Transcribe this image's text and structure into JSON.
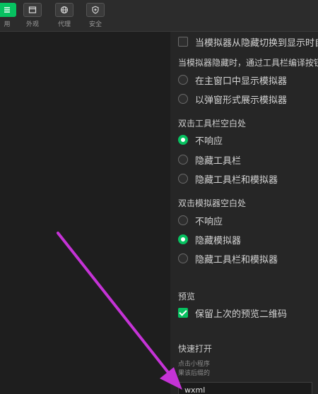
{
  "toolbar": {
    "buttons": [
      {
        "label": "用",
        "icon": "list-icon",
        "active": true
      },
      {
        "label": "外观",
        "icon": "window-icon",
        "active": false
      },
      {
        "label": "代理",
        "icon": "globe-icon",
        "active": false
      },
      {
        "label": "安全",
        "icon": "shield-icon",
        "active": false
      }
    ]
  },
  "settings": {
    "switch_option": "当模拟器从隐藏切换到显示时自",
    "hidden_section": {
      "title": "当模拟器隐藏时，通过工具栏编译按钮",
      "options": [
        "在主窗口中显示模拟器",
        "以弹窗形式展示模拟器"
      ]
    },
    "toolbar_dblclick": {
      "title": "双击工具栏空白处",
      "options": [
        "不响应",
        "隐藏工具栏",
        "隐藏工具栏和模拟器"
      ],
      "selected": 0
    },
    "simulator_dblclick": {
      "title": "双击模拟器空白处",
      "options": [
        "不响应",
        "隐藏模拟器",
        "隐藏工具栏和模拟器"
      ],
      "selected": 1
    },
    "preview": {
      "title": "预览",
      "keep_qrcode": "保留上次的预览二维码",
      "keep_qrcode_checked": true
    },
    "quick_open": {
      "title": "快速打开",
      "hint_line1": "点击小程序",
      "hint_line2": "果该后缀的",
      "input_value": "wxml"
    }
  },
  "colors": {
    "accent": "#07c160",
    "arrow": "#c533d6"
  }
}
